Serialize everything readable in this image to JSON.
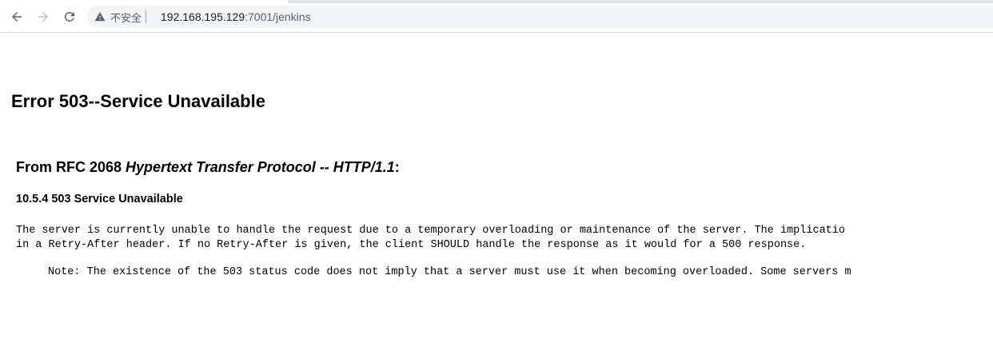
{
  "browser": {
    "security_label": "不安全",
    "url_host": "192.168.195.129",
    "url_rest": ":7001/jenkins",
    "icons": {
      "back": "back-arrow-icon",
      "forward": "forward-arrow-icon",
      "reload": "reload-icon",
      "security": "warning-triangle-icon"
    }
  },
  "page": {
    "title": "Error 503--Service Unavailable",
    "rfc_prefix": "From RFC 2068 ",
    "rfc_italic": "Hypertext Transfer Protocol -- HTTP/1.1",
    "rfc_suffix": ":",
    "section_heading": "10.5.4 503 Service Unavailable",
    "body_line1": "The server is currently unable to handle the request due to a temporary overloading or maintenance of the server. The implicatio",
    "body_line2": "in a Retry-After header. If no Retry-After is given, the client SHOULD handle the response as it would for a 500 response.",
    "note_line": "Note: The existence of the 503 status code does not imply that a server must use it when becoming overloaded. Some servers m"
  },
  "colors": {
    "omnibox_bg": "#f1f3f4",
    "icon_gray": "#5f6368",
    "icon_disabled": "#bdc1c6"
  }
}
